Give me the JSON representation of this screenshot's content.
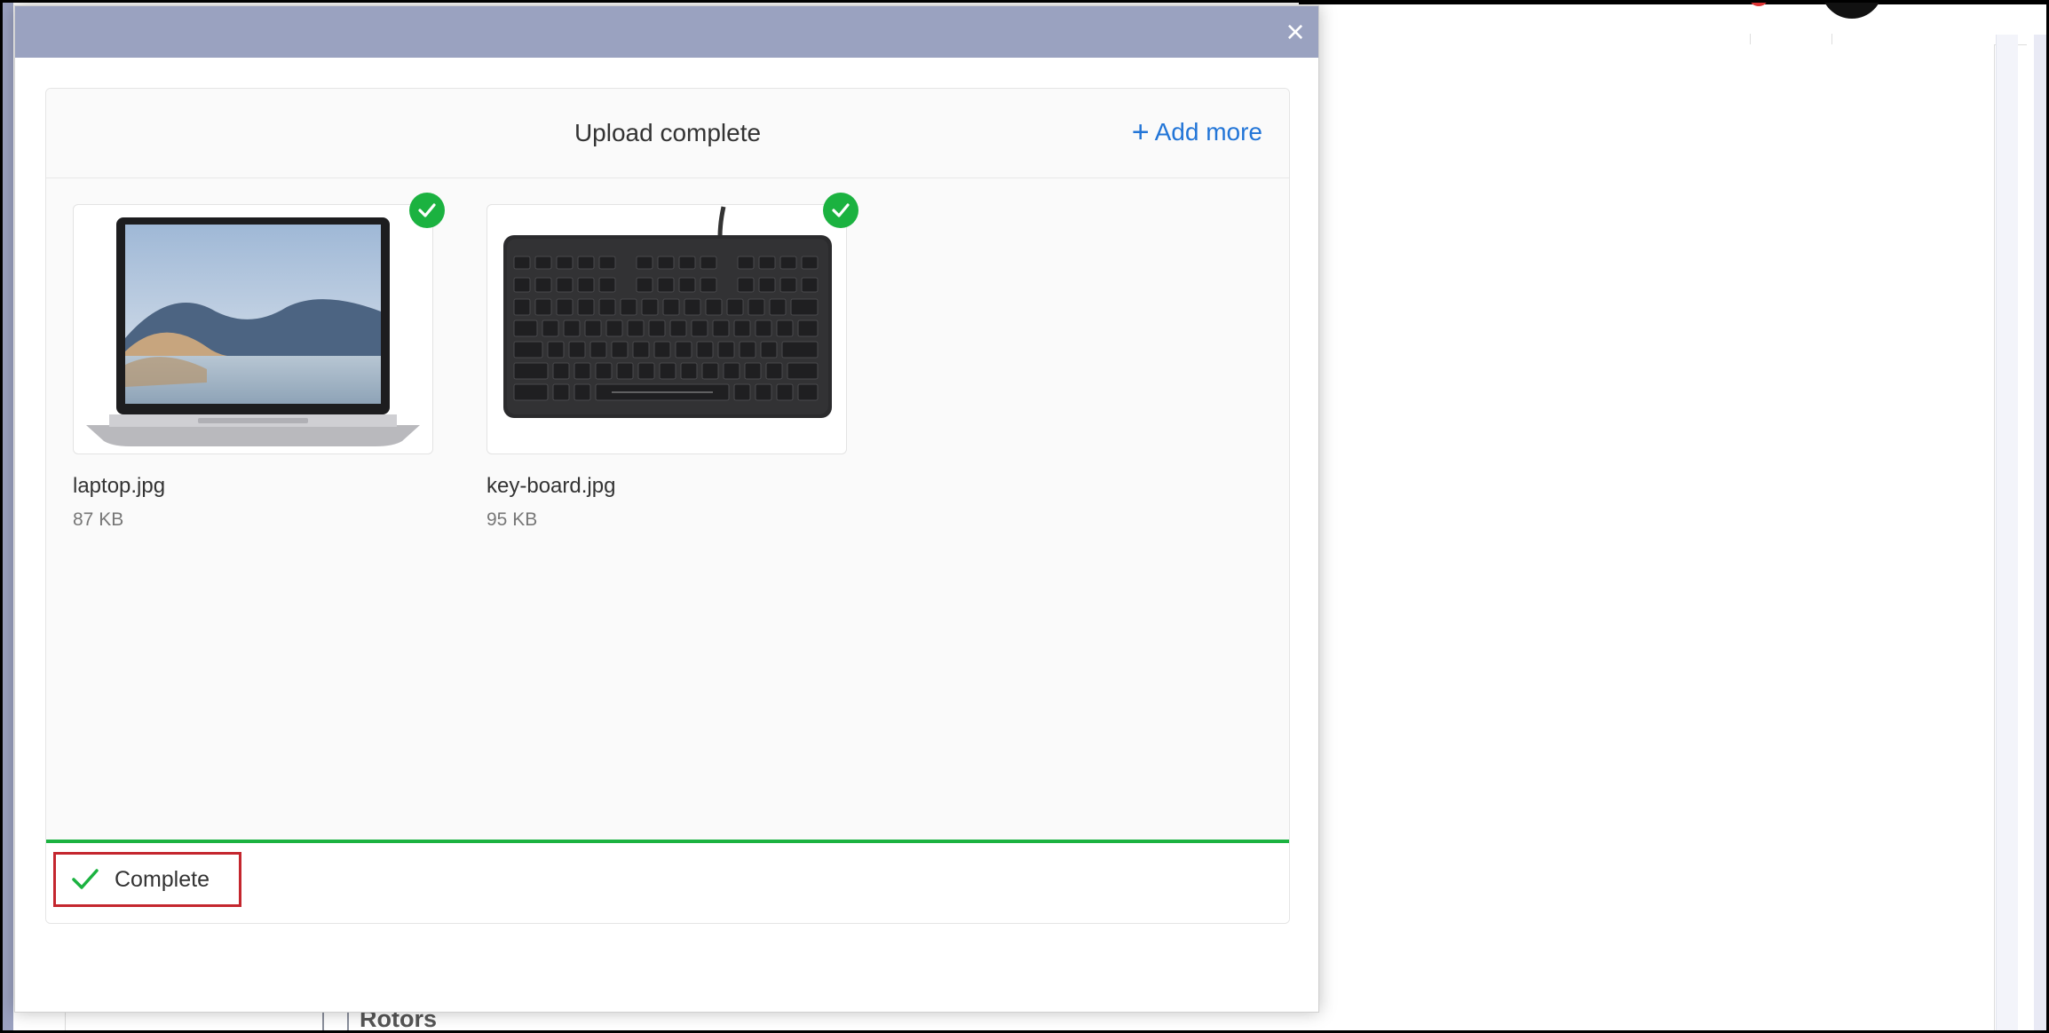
{
  "background": {
    "section_label": "Rotors"
  },
  "modal": {
    "close_label": "×",
    "title": "Upload complete",
    "add_more_label": "Add more",
    "files": [
      {
        "name": "laptop.jpg",
        "size": "87 KB",
        "status": "complete",
        "thumbnail": "laptop-image"
      },
      {
        "name": "key-board.jpg",
        "size": "95 KB",
        "status": "complete",
        "thumbnail": "keyboard-image"
      }
    ],
    "status": {
      "label": "Complete",
      "progress": 1.0
    }
  },
  "colors": {
    "header": "#9aa2c0",
    "accent_blue": "#2275d7",
    "success_green": "#1bb240",
    "highlight_red": "#c4262e"
  }
}
